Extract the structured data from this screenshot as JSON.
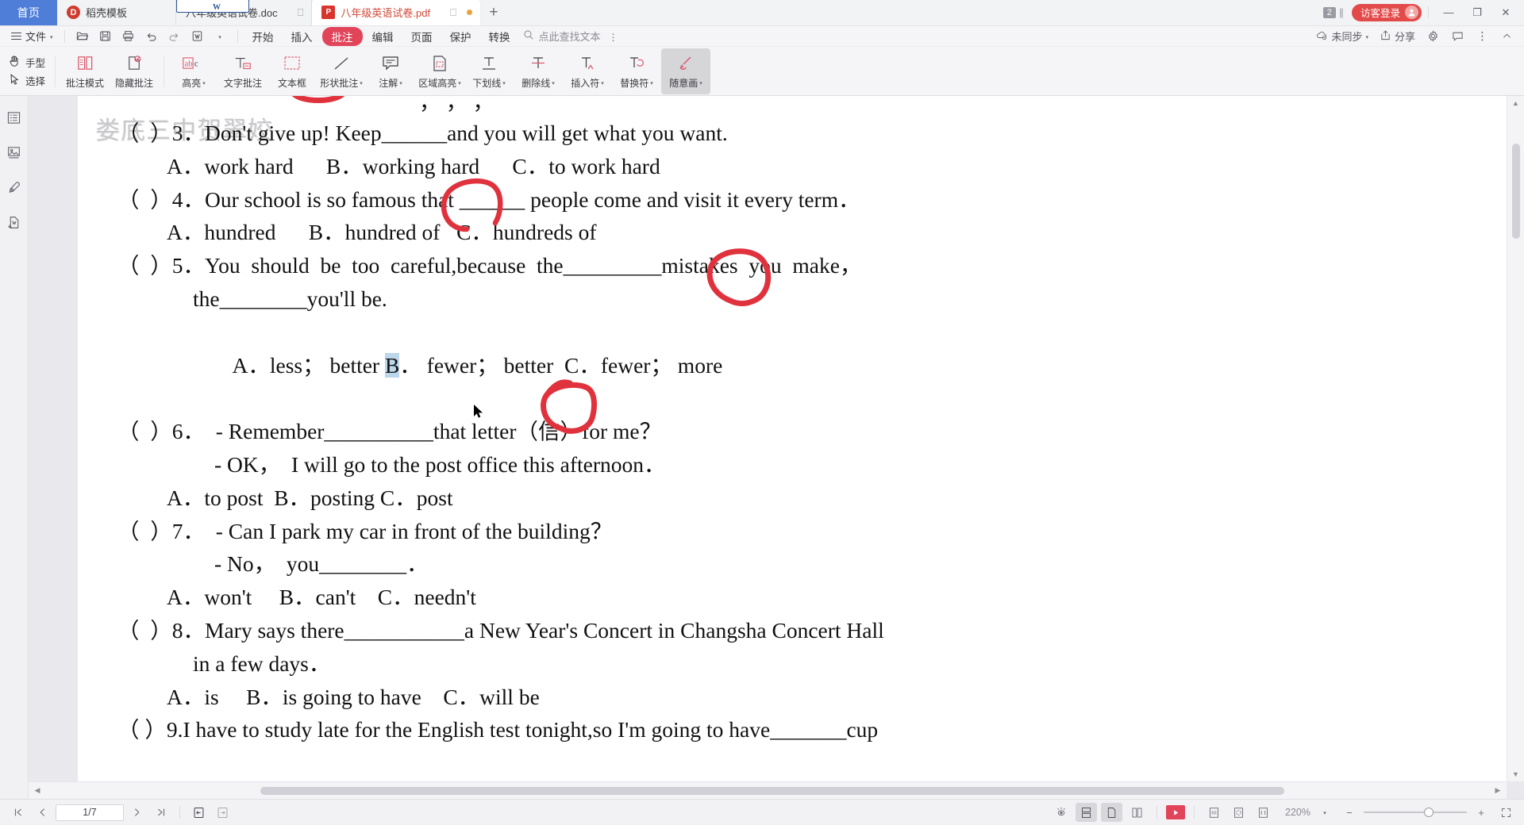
{
  "window": {
    "home_tab": "首页",
    "new_tab_label": "+",
    "tab_count_badge": "2",
    "login_label": "访客登录",
    "minimize": "—",
    "maximize": "❐",
    "close": "✕"
  },
  "tabs": [
    {
      "label": "稻壳模板",
      "icon": "seed-icon",
      "active": false,
      "monitor": ""
    },
    {
      "label": "八年级英语试卷.doc",
      "icon": "word-icon",
      "active": false,
      "monitor": "monitor-icon"
    },
    {
      "label": "八年级英语试卷.pdf",
      "icon": "pdf-icon",
      "active": true,
      "monitor": "monitor-icon"
    }
  ],
  "menubar": {
    "file_label": "文件",
    "quick_icons": [
      "open-icon",
      "save-icon",
      "print-icon",
      "undo-icon",
      "redo-icon",
      "export-icon",
      "more-icon"
    ],
    "tabs": [
      {
        "label": "开始",
        "active": false
      },
      {
        "label": "插入",
        "active": false
      },
      {
        "label": "批注",
        "active": true
      },
      {
        "label": "编辑",
        "active": false
      },
      {
        "label": "页面",
        "active": false
      },
      {
        "label": "保护",
        "active": false
      },
      {
        "label": "转换",
        "active": false
      }
    ],
    "search_placeholder": "点此查找文本",
    "right": [
      {
        "label": "未同步",
        "icon": "cloud-sync-icon"
      },
      {
        "label": "分享",
        "icon": "share-icon"
      },
      {
        "label": "",
        "icon": "gear-icon"
      },
      {
        "label": "",
        "icon": "comment-icon"
      },
      {
        "label": "",
        "icon": "more-vertical-icon"
      },
      {
        "label": "",
        "icon": "chevron-up-icon"
      }
    ]
  },
  "ribbon": {
    "mode_items": [
      {
        "label": "手型",
        "icon": "hand-icon"
      },
      {
        "label": "选择",
        "icon": "cursor-icon"
      }
    ],
    "items": [
      {
        "label": "批注模式",
        "icon": "annotate-mode-icon",
        "caret": false,
        "selected": false
      },
      {
        "label": "隐藏批注",
        "icon": "hide-annotation-icon",
        "caret": false,
        "selected": false
      },
      {
        "label": "高亮",
        "icon": "highlight-abc-icon",
        "caret": true,
        "selected": false
      },
      {
        "label": "文字批注",
        "icon": "text-annotation-icon",
        "caret": false,
        "selected": false
      },
      {
        "label": "文本框",
        "icon": "textbox-icon",
        "caret": false,
        "selected": false
      },
      {
        "label": "形状批注",
        "icon": "shape-annotation-icon",
        "caret": true,
        "selected": false
      },
      {
        "label": "注解",
        "icon": "note-icon",
        "caret": true,
        "selected": false
      },
      {
        "label": "区域高亮",
        "icon": "area-highlight-icon",
        "caret": true,
        "selected": false
      },
      {
        "label": "下划线",
        "icon": "underline-icon",
        "caret": true,
        "selected": false
      },
      {
        "label": "删除线",
        "icon": "strikethrough-icon",
        "caret": true,
        "selected": false
      },
      {
        "label": "插入符",
        "icon": "caret-insert-icon",
        "caret": true,
        "selected": false
      },
      {
        "label": "替换符",
        "icon": "replace-icon",
        "caret": true,
        "selected": false
      },
      {
        "label": "随意画",
        "icon": "freehand-pen-icon",
        "caret": true,
        "selected": true
      }
    ]
  },
  "leftrail": {
    "items": [
      {
        "icon": "outline-icon"
      },
      {
        "icon": "thumbnail-icon"
      },
      {
        "icon": "stamp-icon"
      },
      {
        "icon": "export-page-icon"
      }
    ]
  },
  "document": {
    "watermark": "娄底三中贺翠姣",
    "lines": [
      {
        "id": "q3",
        "indent": 0,
        "text": "（  ）3．Don't give up! Keep______and you will get what you want."
      },
      {
        "id": "q3opt",
        "indent": 1,
        "text": "A．work hard      B．working hard      C．to work hard"
      },
      {
        "id": "q4",
        "indent": 0,
        "text": "（  ）4．Our school is so famous that ______ people come and visit it every term．"
      },
      {
        "id": "q4opt",
        "indent": 1,
        "text": "A．hundred      B．hundred of   C．hundreds of"
      },
      {
        "id": "q5",
        "indent": 0,
        "text": "（  ）5．You  should  be  too  careful,because  the_________mistakes  you  make，"
      },
      {
        "id": "q5b",
        "indent": 2,
        "text": "the________you'll be."
      },
      {
        "id": "q5opt",
        "indent": 1,
        "text": "A．less； better B． fewer； better  C．fewer； more"
      },
      {
        "id": "q6",
        "indent": 0,
        "text": "（  ）6．  - Remember__________that letter（信）for me？"
      },
      {
        "id": "q6b",
        "indent": 3,
        "text": "- OK，  I will go to the post office this afternoon．"
      },
      {
        "id": "q6opt",
        "indent": 1,
        "text": "A．to post  B．posting C．post"
      },
      {
        "id": "q7",
        "indent": 0,
        "text": "（  ）7．  - Can I park my car in front of the building？"
      },
      {
        "id": "q7b",
        "indent": 3,
        "text": "- No，  you________．"
      },
      {
        "id": "q7opt",
        "indent": 1,
        "text": "A．won't     B．can't    C．needn't"
      },
      {
        "id": "q8",
        "indent": 0,
        "text": "（  ）8．Mary says there___________a New Year's Concert in Changsha Concert Hall"
      },
      {
        "id": "q8b",
        "indent": 2,
        "text": "in a few days．"
      },
      {
        "id": "q8opt",
        "indent": 1,
        "text": "A．is     B．is going to have    C．will be"
      },
      {
        "id": "q9",
        "indent": 0,
        "text": "（ ）9.I have to study late for the English test tonight,so I'm going to have_______cup"
      }
    ],
    "annotations": [
      {
        "name": "red-circle-option-B-q3",
        "shape": "circle"
      },
      {
        "name": "red-circle-option-C-q4",
        "shape": "circle"
      },
      {
        "name": "red-circle-option-B-q5",
        "shape": "circle"
      },
      {
        "name": "red-stroke-top-partial",
        "shape": "arc"
      }
    ],
    "selection_highlight_color": "#bcd6ea",
    "pen_color": "#e0323c"
  },
  "status": {
    "first_page": "first-page-icon",
    "prev_page": "prev-page-icon",
    "page_value": "1/7",
    "next_page": "next-page-icon",
    "last_page": "last-page-icon",
    "fit_left": "page-left-icon",
    "fit_right": "page-right-icon",
    "eye_icon": "read-aloud-icon",
    "view_modes": [
      {
        "icon": "continuous-view-icon",
        "active": true
      },
      {
        "icon": "single-page-icon",
        "active": true
      },
      {
        "icon": "double-page-icon",
        "active": false
      }
    ],
    "play_icon": "slideshow-icon",
    "tools": [
      {
        "icon": "actual-size-icon"
      },
      {
        "icon": "fit-page-icon"
      },
      {
        "icon": "fit-width-icon"
      }
    ],
    "zoom_label": "220%",
    "zoom_out": "−",
    "zoom_in": "+",
    "fullscreen": "fullscreen-icon"
  }
}
